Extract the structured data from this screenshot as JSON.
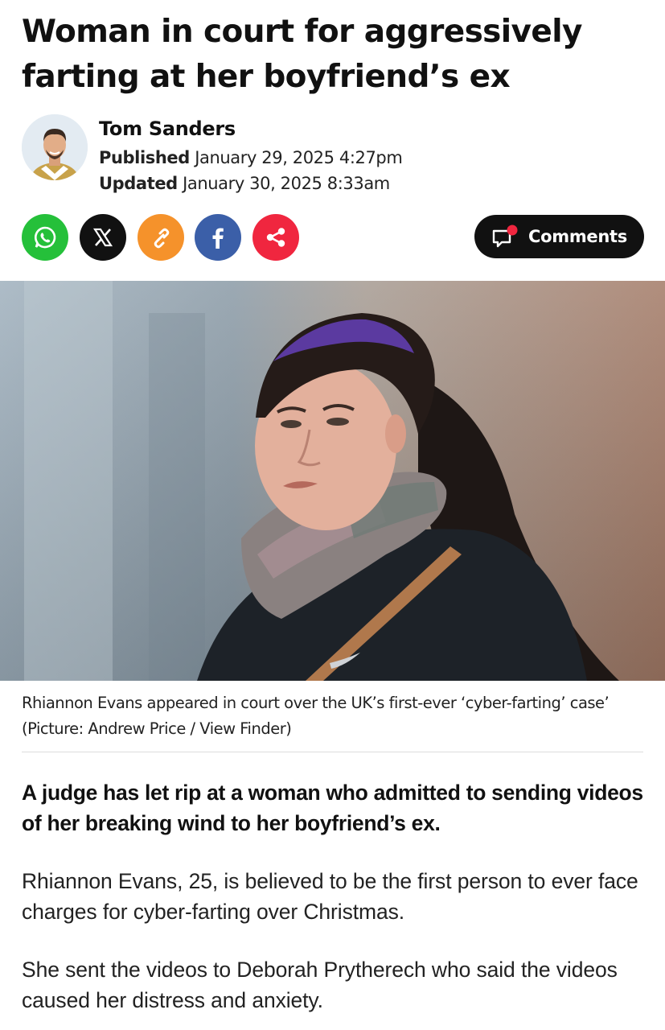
{
  "article": {
    "headline": "Woman in court for aggressively farting at her boyfriend’s ex",
    "author": {
      "name": "Tom Sanders",
      "published_label": "Published",
      "published_value": "January 29, 2025 4:27pm",
      "updated_label": "Updated",
      "updated_value": "January 30, 2025 8:33am"
    },
    "share": {
      "icons": [
        "whatsapp-icon",
        "x-icon",
        "link-icon",
        "facebook-icon",
        "share-icon"
      ],
      "colors": {
        "whatsapp": "#25c03a",
        "x": "#111111",
        "link": "#f5922b",
        "facebook": "#3b5fa8",
        "share": "#f0263f"
      }
    },
    "comments_label": "Comments",
    "image_caption": "Rhiannon Evans appeared in court over the UK’s first-ever ‘cyber-farting’ case’ (Picture: Andrew Price / View Finder)",
    "standfirst": "A judge has let rip at a woman who admitted to sending videos of her breaking wind to her boyfriend’s ex.",
    "paragraphs": [
      "Rhiannon Evans, 25, is believed to be the first person to ever face charges for cyber-farting over Christmas.",
      "She sent the videos to Deborah Prytherech who said the videos caused her distress and anxiety."
    ]
  }
}
